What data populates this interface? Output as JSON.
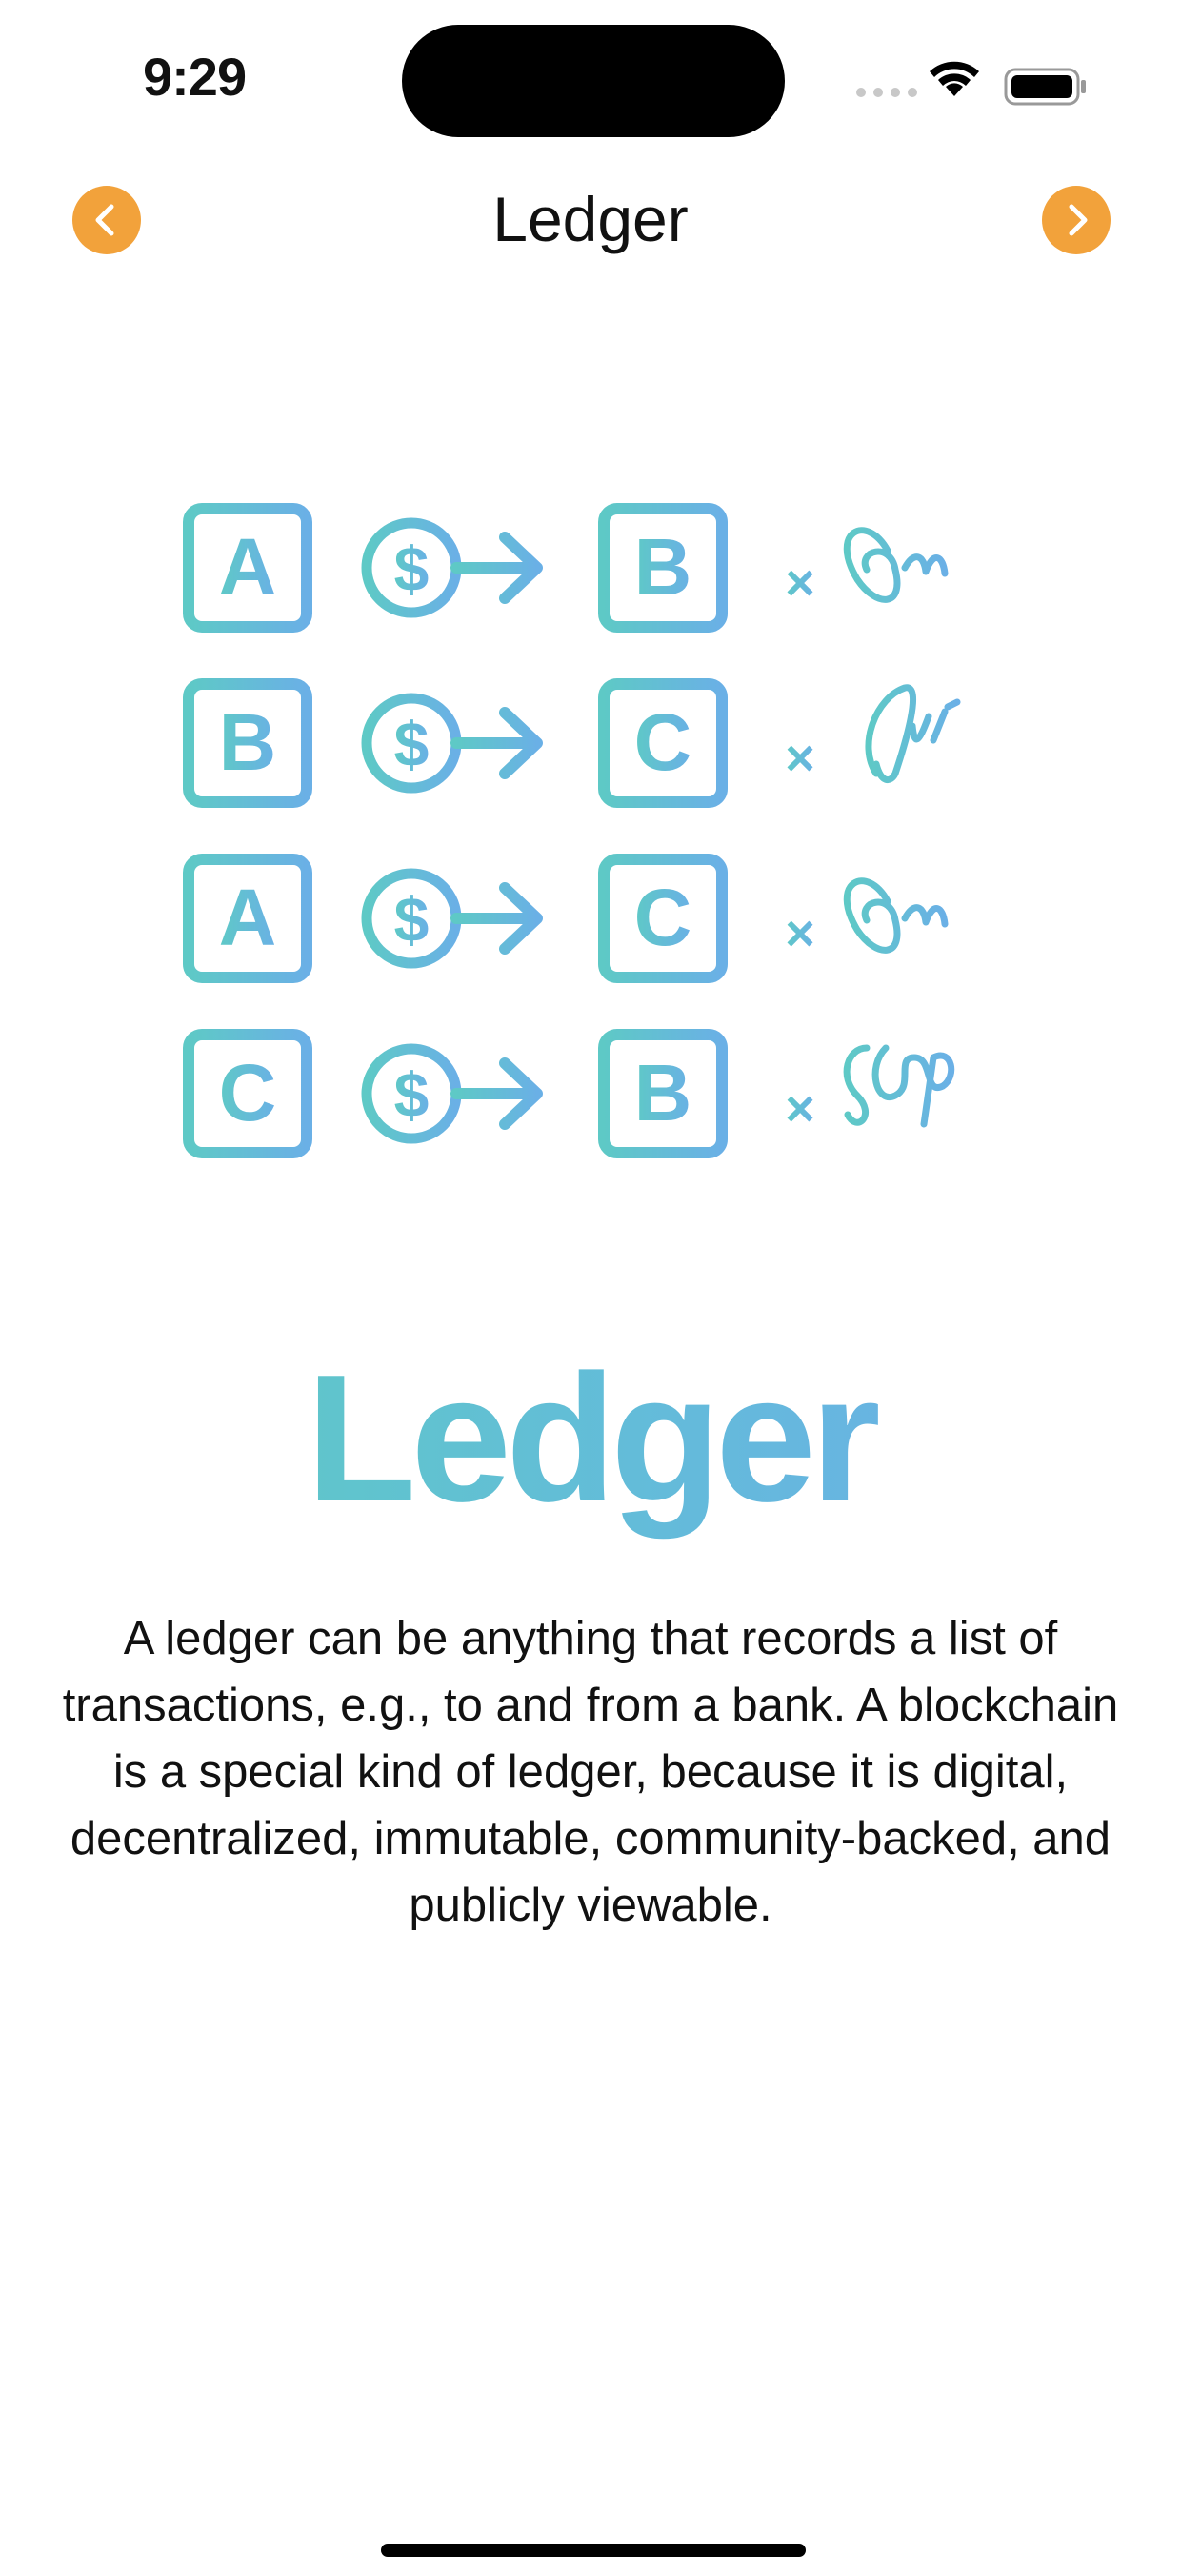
{
  "status_bar": {
    "time": "9:29"
  },
  "nav": {
    "title": "Ledger",
    "back_icon": "chevron-left-icon",
    "forward_icon": "chevron-right-icon",
    "accent_color": "#f2a23b"
  },
  "illustration": {
    "rows": [
      {
        "from": "A",
        "to": "B",
        "signature": "signature-1"
      },
      {
        "from": "B",
        "to": "C",
        "signature": "signature-2"
      },
      {
        "from": "A",
        "to": "C",
        "signature": "signature-1"
      },
      {
        "from": "C",
        "to": "B",
        "signature": "signature-3"
      }
    ],
    "coin_symbol": "$",
    "sign_mark": "×",
    "gradient_start": "#5ec9c6",
    "gradient_end": "#6ab0e6"
  },
  "hero": {
    "title": "Ledger"
  },
  "body": {
    "text": "A ledger can be anything that records a list of transactions, e.g., to and from a bank. A blockchain is a special kind of ledger, because it is digital, decentralized, immutable, community-backed, and publicly viewable."
  }
}
